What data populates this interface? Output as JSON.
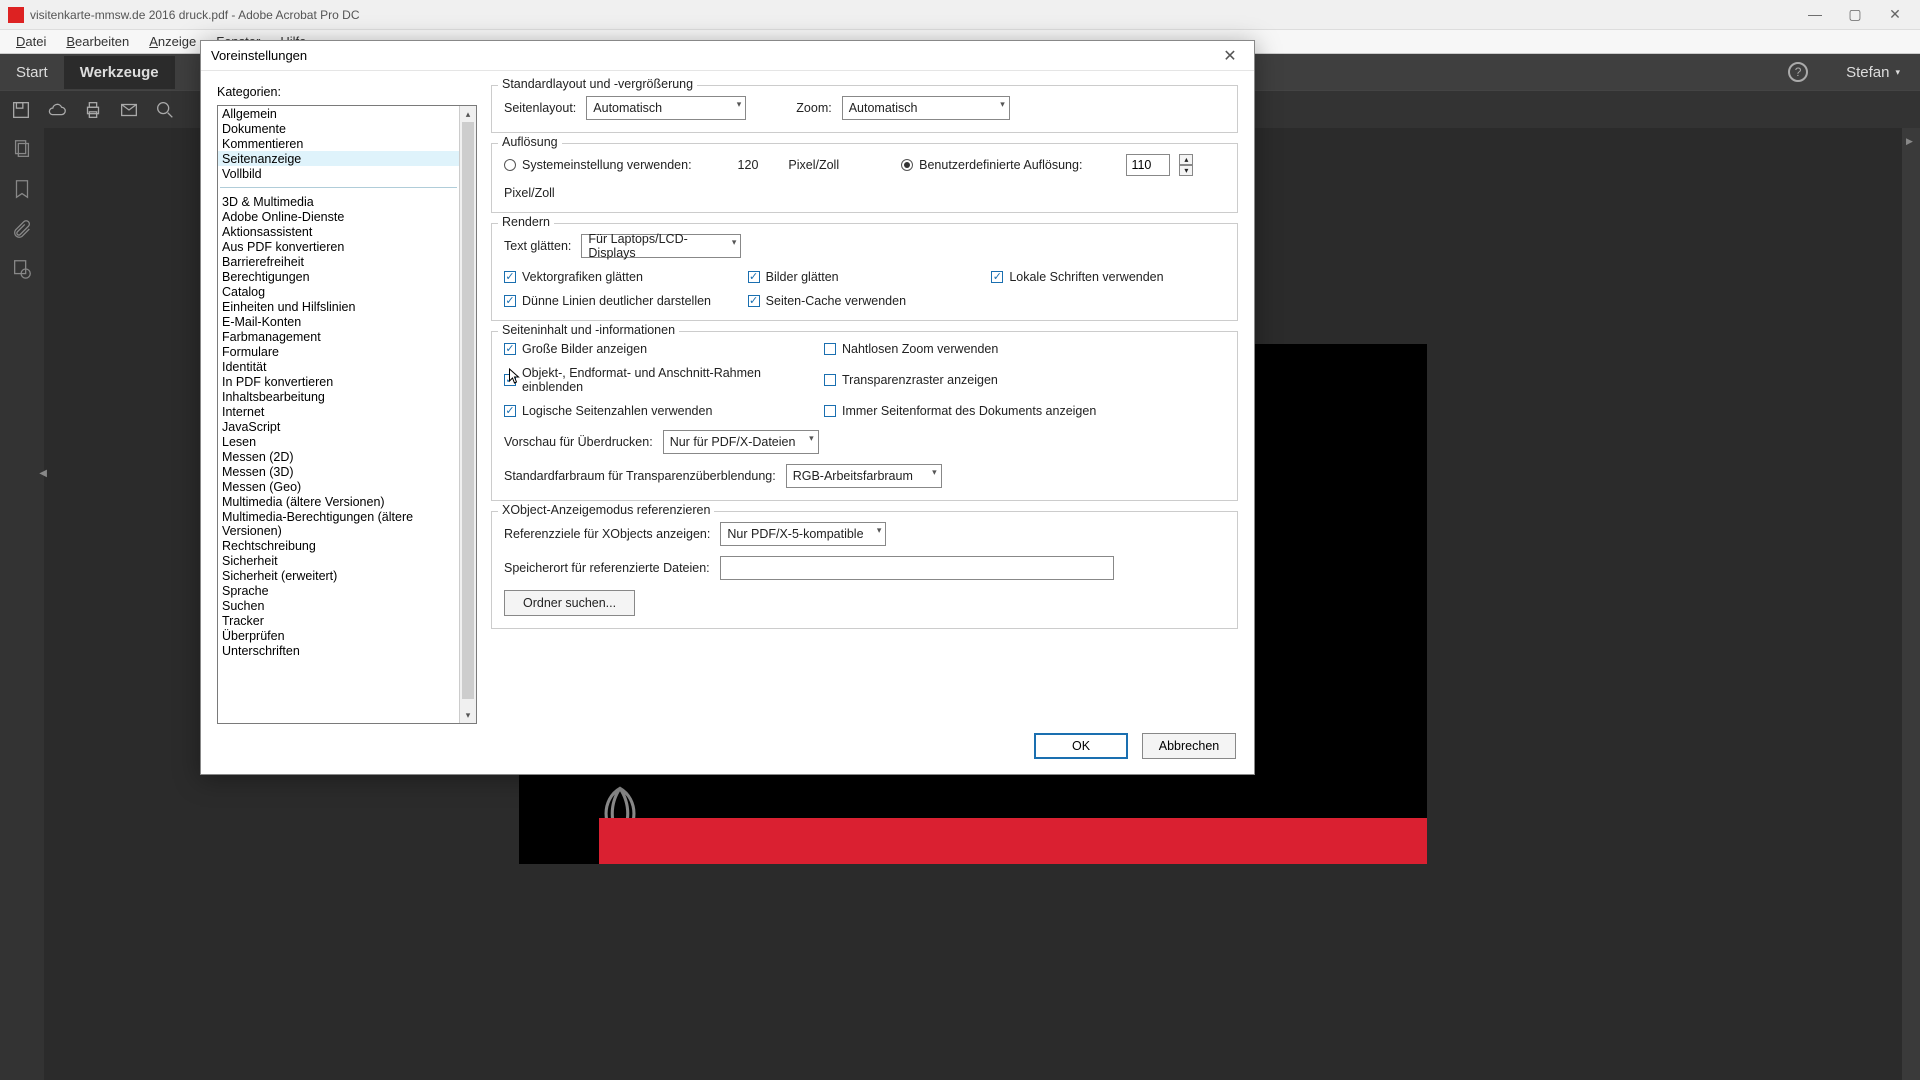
{
  "window": {
    "title": "visitenkarte-mmsw.de 2016 druck.pdf - Adobe Acrobat Pro DC",
    "min": "—",
    "max": "▢",
    "close": "✕"
  },
  "menu": {
    "items": [
      "Datei",
      "Bearbeiten",
      "Anzeige",
      "Fenster",
      "Hilfe"
    ]
  },
  "tabs": {
    "start": "Start",
    "tools": "Werkzeuge",
    "user": "Stefan"
  },
  "dialog": {
    "title": "Voreinstellungen",
    "categories_label": "Kategorien:",
    "categories_top": [
      "Allgemein",
      "Dokumente",
      "Kommentieren",
      "Seitenanzeige",
      "Vollbild"
    ],
    "categories_rest": [
      "3D & Multimedia",
      "Adobe Online-Dienste",
      "Aktionsassistent",
      "Aus PDF konvertieren",
      "Barrierefreiheit",
      "Berechtigungen",
      "Catalog",
      "Einheiten und Hilfslinien",
      "E-Mail-Konten",
      "Farbmanagement",
      "Formulare",
      "Identität",
      "In PDF konvertieren",
      "Inhaltsbearbeitung",
      "Internet",
      "JavaScript",
      "Lesen",
      "Messen (2D)",
      "Messen (3D)",
      "Messen (Geo)",
      "Multimedia (ältere Versionen)",
      "Multimedia-Berechtigungen (ältere Versionen)",
      "Rechtschreibung",
      "Sicherheit",
      "Sicherheit (erweitert)",
      "Sprache",
      "Suchen",
      "Tracker",
      "Überprüfen",
      "Unterschriften"
    ],
    "selected_category": "Seitenanzeige",
    "layout": {
      "legend": "Standardlayout und -vergrößerung",
      "page_layout_label": "Seitenlayout:",
      "page_layout_value": "Automatisch",
      "zoom_label": "Zoom:",
      "zoom_value": "Automatisch"
    },
    "resolution": {
      "legend": "Auflösung",
      "system_label": "Systemeinstellung verwenden:",
      "system_value": "120",
      "unit": "Pixel/Zoll",
      "custom_label": "Benutzerdefinierte Auflösung:",
      "custom_value": "110"
    },
    "rendering": {
      "legend": "Rendern",
      "smooth_text_label": "Text glätten:",
      "smooth_text_value": "Für Laptops/LCD-Displays",
      "vector": "Vektorgrafiken glätten",
      "images": "Bilder glätten",
      "local_fonts": "Lokale Schriften verwenden",
      "thin_lines": "Dünne Linien deutlicher darstellen",
      "page_cache": "Seiten-Cache verwenden"
    },
    "content": {
      "legend": "Seiteninhalt und -informationen",
      "large_images": "Große Bilder anzeigen",
      "seamless_zoom": "Nahtlosen Zoom verwenden",
      "boxes": "Objekt-, Endformat- und Anschnitt-Rahmen einblenden",
      "transparency_grid": "Transparenzraster anzeigen",
      "logical_pages": "Logische Seitenzahlen verwenden",
      "always_pagesize": "Immer Seitenformat des Dokuments anzeigen",
      "overprint_label": "Vorschau für Überdrucken:",
      "overprint_value": "Nur für PDF/X-Dateien",
      "blend_space_label": "Standardfarbraum für Transparenzüberblendung:",
      "blend_space_value": "RGB-Arbeitsfarbraum"
    },
    "xobject": {
      "legend": "XObject-Anzeigemodus referenzieren",
      "targets_label": "Referenzziele für XObjects anzeigen:",
      "targets_value": "Nur PDF/X-5-kompatible",
      "location_label": "Speicherort für referenzierte Dateien:",
      "browse": "Ordner suchen..."
    },
    "buttons": {
      "ok": "OK",
      "cancel": "Abbrechen"
    }
  }
}
